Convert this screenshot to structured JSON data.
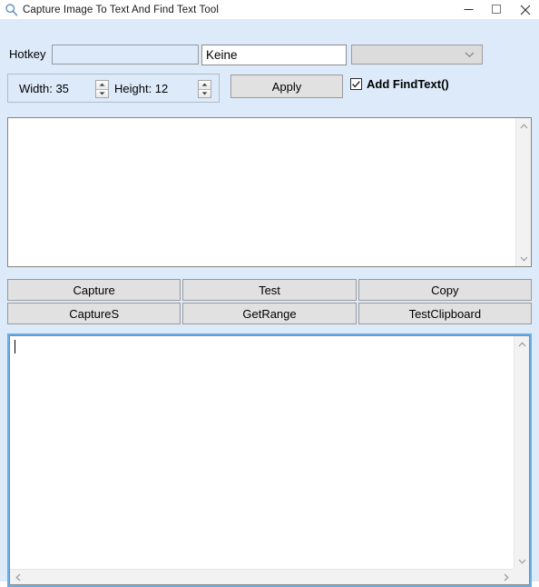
{
  "window": {
    "title": "Capture Image To Text And Find Text Tool",
    "icon": "magnifier-icon",
    "background_color": "#dceafa",
    "controls": {
      "minimize": "minimize-icon",
      "maximize": "maximize-icon",
      "close": "close-icon"
    }
  },
  "toolbar": {
    "hotkey_label": "Hotkey",
    "hotkey_input_value": "",
    "hotkey_input_placeholder": "",
    "modifier_field_value": "Keine",
    "modifier_field_placeholder": "",
    "combo_selected": "",
    "combo_icon": "chevron-down-icon",
    "size_group": {
      "width_label": "Width: 35",
      "width_value": 35,
      "height_label": "Height: 12",
      "height_value": 12,
      "spinner_up_icon": "spinner-up-icon",
      "spinner_down_icon": "spinner-down-icon"
    },
    "apply_label": "Apply",
    "findtext_checkbox": {
      "label": "Add FindText()",
      "checked": true,
      "icon": "checkmark-icon"
    }
  },
  "output_area": {
    "value": "",
    "scrollbar": {
      "up_icon": "scroll-up-icon",
      "down_icon": "scroll-down-icon"
    }
  },
  "actions": {
    "rows": [
      [
        {
          "label": "Capture",
          "name": "capture-button"
        },
        {
          "label": "Test",
          "name": "test-button"
        },
        {
          "label": "Copy",
          "name": "copy-button"
        }
      ],
      [
        {
          "label": "CaptureS",
          "name": "captures-button"
        },
        {
          "label": "GetRange",
          "name": "getrange-button"
        },
        {
          "label": "TestClipboard",
          "name": "testclipboard-button"
        }
      ]
    ]
  },
  "input_area": {
    "value": "",
    "focused": true,
    "focus_color": "#6aaee8",
    "scrollbar": {
      "up_icon": "scroll-up-icon",
      "down_icon": "scroll-down-icon",
      "left_icon": "scroll-left-icon",
      "right_icon": "scroll-right-icon"
    }
  }
}
